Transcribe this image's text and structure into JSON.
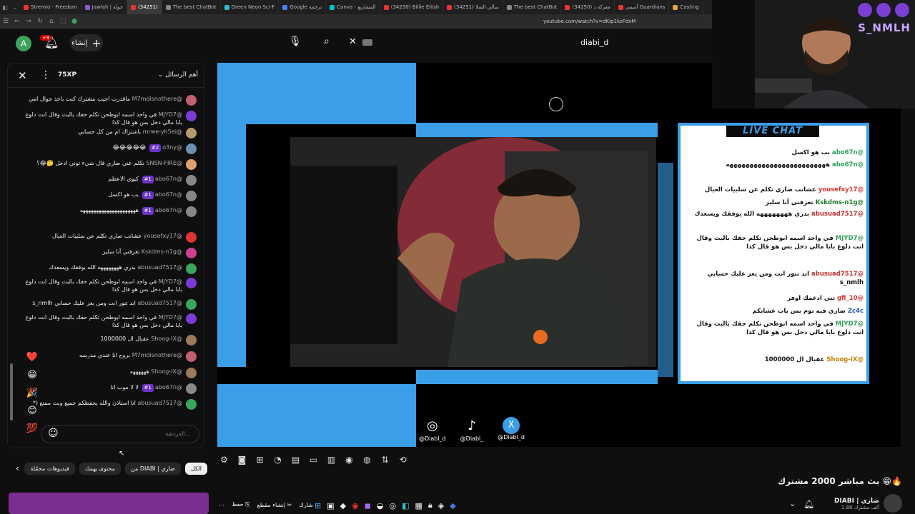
{
  "browser": {
    "tabs": [
      "Stremio - Freedom",
      "Jawlah | جولة",
      "(34251)",
      "The best ChatBot",
      "Green Neon Sci-F",
      "Google ترجمة",
      "Canva - المشاريع",
      "(34250) Billie Eilish",
      "(34251) سالي الضلا",
      "The best ChatBot",
      "(34250) معركة د",
      "أسمي Guardians",
      "Casting"
    ],
    "url": "youtube.com/watch?v=dKip1kzFdxM"
  },
  "header": {
    "avatar_letter": "A",
    "notif_count": "+9",
    "create_label": "إنشاء",
    "search_query": "diabi_d"
  },
  "chat": {
    "xp": "75XP",
    "top_chat_label": "أهم الرسائل",
    "input_placeholder": "الدردشة...",
    "messages": [
      {
        "name": "@M7mdisnothere",
        "text": "ماقدرت اجيب مشترك كنت باخذ جوال امي",
        "color": "#c06070"
      },
      {
        "name": "@MJYD7",
        "text": "في واحد اسمه ابوطحن تكلم حقك بالبث وقال انت دلوع بابا مالي دخل بس هو قال كذا",
        "color": "#7a3bd6"
      },
      {
        "name": "@mrwe-yh5ei",
        "text": "باشتراك ام من كل حسابي",
        "color": "#b39b6b"
      },
      {
        "name": "@o3ny",
        "text": "😂😂😂😂😂",
        "color": "#6b8fb0",
        "badge": "#2"
      },
      {
        "name": "@SNSN-FIRE",
        "text": "تكلم عني ضاري قال شيء توني ادخل 🤔😂؟",
        "color": "#e0a070"
      },
      {
        "name": "@abo67n",
        "text": "كيوي الاعظم",
        "color": "#888",
        "badge": "#1"
      },
      {
        "name": "@abo67n",
        "text": "بب هو اكسل",
        "color": "#888",
        "badge": "#1"
      },
      {
        "name": "@abo67n",
        "text": "هههههههههههههههههههههه",
        "color": "#888",
        "badge": "#1"
      },
      {
        "name": "@yousefxy17",
        "text": "عشانب ضاري تكلم عن سلبيات العيال",
        "color": "#d33"
      },
      {
        "name": "@Kskdms-n1g",
        "text": "تعرفني أنا سليز",
        "color": "#d04090"
      },
      {
        "name": "@abusuad7517",
        "text": "بدري ههههههههه الله يوفقك ويسعدك",
        "color": "#3ba55c"
      },
      {
        "name": "@MJYD7",
        "text": "في واحد اسمه ابوطحن تكلم حقك بالبث وقال انت دلوع بابا مالي دخل بس هو قال كذا",
        "color": "#7a3bd6"
      },
      {
        "name": "@abusuad7517",
        "text": "ابد تنور انت ومن يعز عليك حسابي s_nmlh",
        "color": "#3ba55c"
      },
      {
        "name": "@MJYD7",
        "text": "في واحد اسمه ابوطحن تكلم حقك بالبث وقال انت دلوع بابا مالي دخل بس هو قال كذا",
        "color": "#7a3bd6"
      },
      {
        "name": "@Shoog-IX",
        "text": "عقبال ال 1000000",
        "color": "#9a7a5a"
      },
      {
        "name": "@M7mdisnothere",
        "text": "بروح انا عندي مدرسه",
        "color": "#c06070"
      },
      {
        "name": "@Shoog-IX",
        "text": "ههههههه",
        "color": "#9a7a5a"
      },
      {
        "name": "@abo67n",
        "text": "لا لا موب انا",
        "color": "#888",
        "badge": "#1"
      },
      {
        "name": "@abusuad7517",
        "text": "انا استاذن والله يحفظكم جميع وبث ممتع (*",
        "color": "#3ba55c"
      }
    ],
    "reactions": [
      "❤️",
      "😁",
      "🎉",
      "😊",
      "💯"
    ]
  },
  "player": {
    "live_chat_title": "LIVE CHAT",
    "overlay_lines": [
      {
        "name": "@abo67n",
        "text": "بب هو اكسل",
        "color": "#2e9e57"
      },
      {
        "name": "@abo67n",
        "text": "هههههههههههههههههههههههههه",
        "color": "#2e9e57"
      },
      {
        "name": "@yousefxy17",
        "text": "عشانب ضاري تكلم عن سلبيات العيال",
        "color": "#d33"
      },
      {
        "name": "@Kskdms-n1g",
        "text": "تعرفني أنا سليز",
        "color": "#1a7a2a"
      },
      {
        "name": "@abusuad7517",
        "text": "بدري ههههههههه الله يوفقك ويسعدك",
        "color": "#c03030"
      },
      {
        "name": "@MJYD7",
        "text": "في واحد اسمه ابوطحن تكلم حقك بالبث وقال انت دلوع بابا مالي دخل بس هو قال كذا",
        "color": "#2e9e57"
      },
      {
        "name": "@abusuad7517",
        "text": "ابد تنور انت ومن يعز عليك حسابي s_nmlh",
        "color": "#c03030"
      },
      {
        "name": "@gfi_10",
        "text": "تبي ادعمك اوفر",
        "color": "#d33"
      },
      {
        "name": "Zc4c",
        "text": "ضاري فيه نوم بس بات عشانكم",
        "color": "#2a5fc0"
      },
      {
        "name": "@MJYD7",
        "text": "في واحد اسمه ابوطحن تكلم حقك بالبث وقال انت دلوع بابا مالي دخل بس هو قال كذا",
        "color": "#2e9e57"
      },
      {
        "name": "@Shoog-IX",
        "text": "عقبال ال 1000000",
        "color": "#c08000"
      }
    ],
    "socials": [
      "@Diabl_d",
      "@Diabl_",
      "@Diabl_d"
    ]
  },
  "facecam": {
    "brand": "S_NMLH"
  },
  "chips": [
    "الكل",
    "من DIABI | ضاري",
    "محتوى يهمك",
    "فيديوهات محمّلة"
  ],
  "video": {
    "title": "بث مباشر 2000 مشترك 😁🔥",
    "channel": "DIABI | ضاري",
    "subs": "1.88 ألف مشترك",
    "actions": [
      "حفظ",
      "إنشاء مقطع",
      "شارك"
    ]
  }
}
